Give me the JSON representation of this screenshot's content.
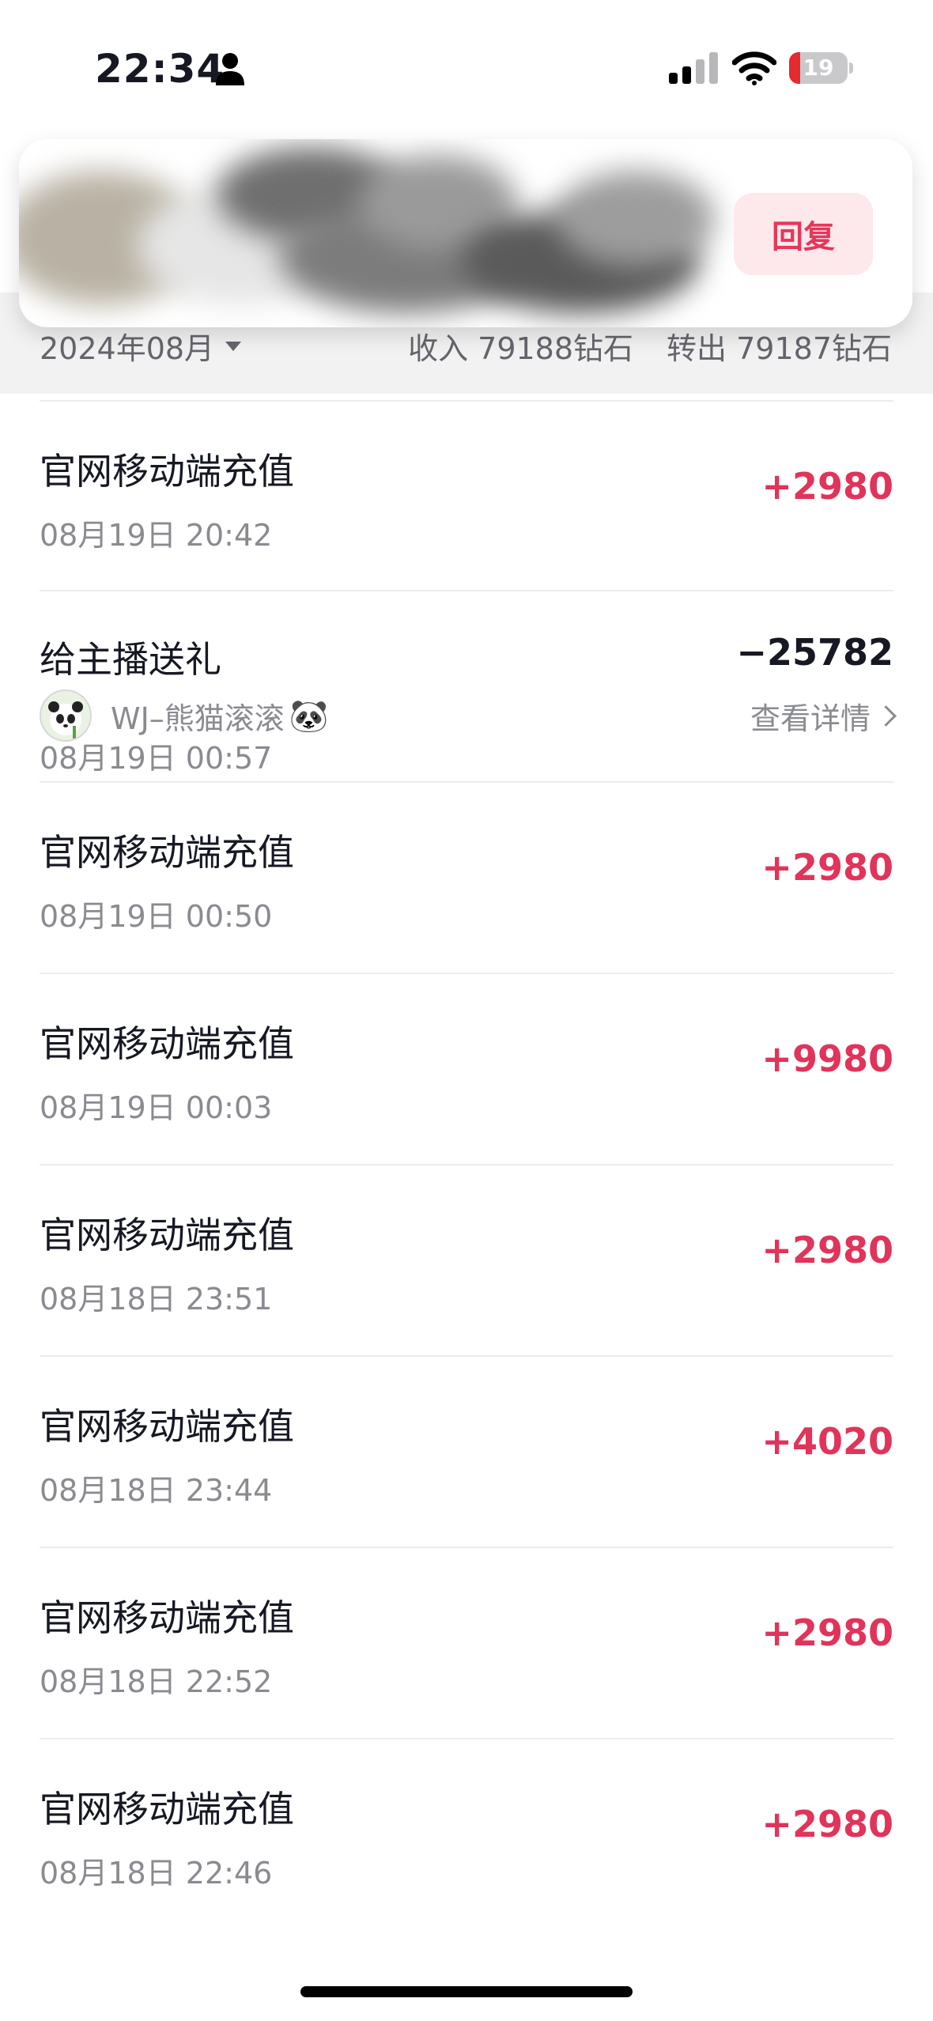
{
  "status_bar": {
    "time": "22:34",
    "battery_level": "19",
    "battery_fraction": 0.19,
    "icons": [
      "person-icon",
      "signal-icon",
      "wifi-icon",
      "battery-icon"
    ]
  },
  "notification": {
    "reply_label": "回复"
  },
  "summary": {
    "month": "2024年08月",
    "income": "收入 79188钻石",
    "transfer_out": "转出 79187钻石"
  },
  "transactions": [
    {
      "title": "官网移动端充值",
      "date": "08月19日 20:42",
      "amount": "+2980",
      "type": "positive"
    },
    {
      "title": "给主播送礼",
      "date": "08月19日 00:57",
      "amount": "−25782",
      "type": "negative",
      "user": "WJ–熊猫滚滚",
      "user_icon": "panda-icon",
      "detail_label": "查看详情"
    },
    {
      "title": "官网移动端充值",
      "date": "08月19日 00:50",
      "amount": "+2980",
      "type": "positive"
    },
    {
      "title": "官网移动端充值",
      "date": "08月19日 00:03",
      "amount": "+9980",
      "type": "positive"
    },
    {
      "title": "官网移动端充值",
      "date": "08月18日 23:51",
      "amount": "+2980",
      "type": "positive"
    },
    {
      "title": "官网移动端充值",
      "date": "08月18日 23:44",
      "amount": "+4020",
      "type": "positive"
    },
    {
      "title": "官网移动端充值",
      "date": "08月18日 22:52",
      "amount": "+2980",
      "type": "positive"
    },
    {
      "title": "官网移动端充值",
      "date": "08月18日 22:46",
      "amount": "+2980",
      "type": "positive"
    }
  ],
  "colors": {
    "positive_amount": "#e0345a",
    "negative_amount": "#161823",
    "summary_background": "#f2f2f3"
  }
}
